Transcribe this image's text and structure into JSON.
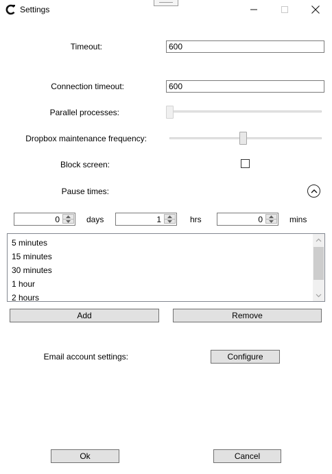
{
  "window": {
    "title": "Settings"
  },
  "fields": {
    "timeout_label": "Timeout:",
    "timeout_value": "600",
    "connection_timeout_label": "Connection timeout:",
    "connection_timeout_value": "600",
    "parallel_processes_label": "Parallel processes:",
    "parallel_processes_level": 0.0,
    "dropbox_frequency_label": "Dropbox maintenance frequency:",
    "dropbox_frequency_level": 0.48,
    "block_screen_label": "Block screen:",
    "block_screen_checked": false,
    "pause_times_label": "Pause times:"
  },
  "pause_input": {
    "days_value": "0",
    "days_label": "days",
    "hrs_value": "1",
    "hrs_label": "hrs",
    "mins_value": "0",
    "mins_label": "mins"
  },
  "pause_list": [
    "5 minutes",
    "15 minutes",
    "30 minutes",
    "1 hour",
    "2 hours"
  ],
  "buttons": {
    "add": "Add",
    "remove": "Remove",
    "configure": "Configure",
    "ok": "Ok",
    "cancel": "Cancel"
  },
  "email": {
    "label": "Email account settings:"
  }
}
